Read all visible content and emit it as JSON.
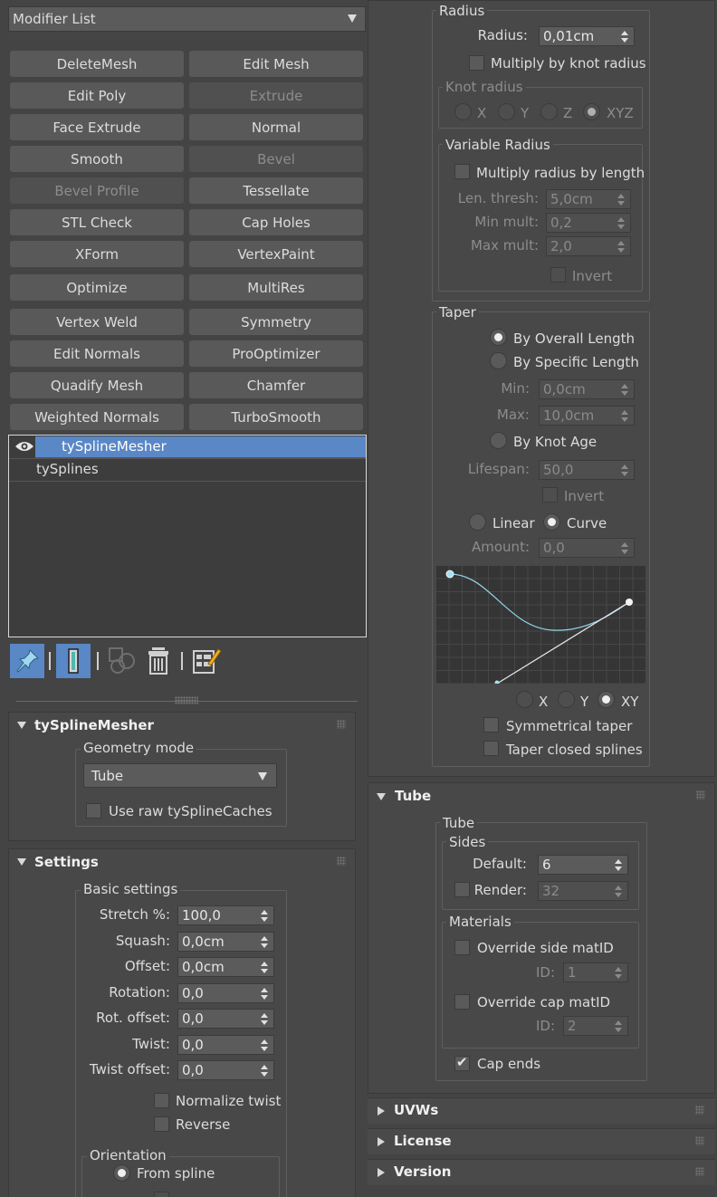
{
  "modifier_list": {
    "label": "Modifier List"
  },
  "modifier_buttons": [
    {
      "label": "DeleteMesh",
      "enabled": true
    },
    {
      "label": "Edit Mesh",
      "enabled": true
    },
    {
      "label": "Edit Poly",
      "enabled": true
    },
    {
      "label": "Extrude",
      "enabled": false
    },
    {
      "label": "Face Extrude",
      "enabled": true
    },
    {
      "label": "Normal",
      "enabled": true
    },
    {
      "label": "Smooth",
      "enabled": true
    },
    {
      "label": "Bevel",
      "enabled": false
    },
    {
      "label": "Bevel Profile",
      "enabled": false
    },
    {
      "label": "Tessellate",
      "enabled": true
    },
    {
      "label": "STL Check",
      "enabled": true
    },
    {
      "label": "Cap Holes",
      "enabled": true
    },
    {
      "label": "XForm",
      "enabled": true
    },
    {
      "label": "VertexPaint",
      "enabled": true
    },
    {
      "label": "Optimize",
      "enabled": true
    },
    {
      "label": "MultiRes",
      "enabled": true
    },
    {
      "label": "Vertex Weld",
      "enabled": true
    },
    {
      "label": "Symmetry",
      "enabled": true
    },
    {
      "label": "Edit Normals",
      "enabled": true
    },
    {
      "label": "ProOptimizer",
      "enabled": true
    },
    {
      "label": "Quadify Mesh",
      "enabled": true
    },
    {
      "label": "Chamfer",
      "enabled": true
    },
    {
      "label": "Weighted Normals",
      "enabled": true
    },
    {
      "label": "TurboSmooth",
      "enabled": true
    }
  ],
  "stack": {
    "items": [
      "tySplineMesher",
      "tySplines"
    ],
    "selected": "tySplineMesher"
  },
  "toolbar_icons": [
    "pin-stack-icon",
    "show-end-result-icon",
    "make-unique-icon",
    "remove-modifier-icon",
    "configure-modifier-sets-icon"
  ],
  "tyspline_rollout": {
    "title": "tySplineMesher",
    "geometry_mode_label": "Geometry mode",
    "geometry_mode_value": "Tube",
    "use_raw_label": "Use raw tySplineCaches"
  },
  "settings": {
    "title": "Settings",
    "basic_label": "Basic settings",
    "fields": [
      {
        "label": "Stretch %:",
        "value": "100,0"
      },
      {
        "label": "Squash:",
        "value": "0,0cm"
      },
      {
        "label": "Offset:",
        "value": "0,0cm"
      },
      {
        "label": "Rotation:",
        "value": "0,0"
      },
      {
        "label": "Rot. offset:",
        "value": "0,0"
      },
      {
        "label": "Twist:",
        "value": "0,0"
      },
      {
        "label": "Twist offset:",
        "value": "0,0"
      }
    ],
    "normalize_twist_label": "Normalize twist",
    "reverse_label": "Reverse",
    "orientation_label": "Orientation",
    "from_spline_label": "From spline"
  },
  "radius": {
    "group_label": "Radius",
    "radius_label": "Radius:",
    "radius_value": "0,01cm",
    "multiply_knot_label": "Multiply by knot radius",
    "knot_radius_label": "Knot radius",
    "axes": [
      "X",
      "Y",
      "Z",
      "XYZ"
    ],
    "variable_label": "Variable Radius",
    "multiply_length_label": "Multiply radius by length",
    "len_thresh_label": "Len. thresh:",
    "len_thresh_value": "5,0cm",
    "min_mult_label": "Min mult:",
    "min_mult_value": "0,2",
    "max_mult_label": "Max mult:",
    "max_mult_value": "2,0",
    "invert_label": "Invert"
  },
  "taper": {
    "group_label": "Taper",
    "overall_label": "By Overall Length",
    "specific_label": "By Specific Length",
    "min_label": "Min:",
    "min_value": "0,0cm",
    "max_label": "Max:",
    "max_value": "10,0cm",
    "knot_age_label": "By Knot Age",
    "lifespan_label": "Lifespan:",
    "lifespan_value": "50,0",
    "invert_label": "Invert",
    "linear_label": "Linear",
    "curve_label": "Curve",
    "amount_label": "Amount:",
    "amount_value": "0,0",
    "axes": [
      "X",
      "Y",
      "XY"
    ],
    "symmetrical_label": "Symmetrical taper",
    "closed_label": "Taper closed splines"
  },
  "tube": {
    "title": "Tube",
    "group_label": "Tube",
    "sides_label": "Sides",
    "default_label": "Default:",
    "default_value": "6",
    "render_label": "Render:",
    "render_value": "32",
    "materials_label": "Materials",
    "override_side_label": "Override side matID",
    "id_label": "ID:",
    "side_id_value": "1",
    "override_cap_label": "Override cap matID",
    "cap_id_value": "2",
    "cap_ends_label": "Cap ends"
  },
  "collapsed_rollouts": [
    "UVWs",
    "License",
    "Version"
  ],
  "colors": {
    "accent": "#5a87c6",
    "panel": "#444444",
    "curve": "#8fd3e6"
  }
}
